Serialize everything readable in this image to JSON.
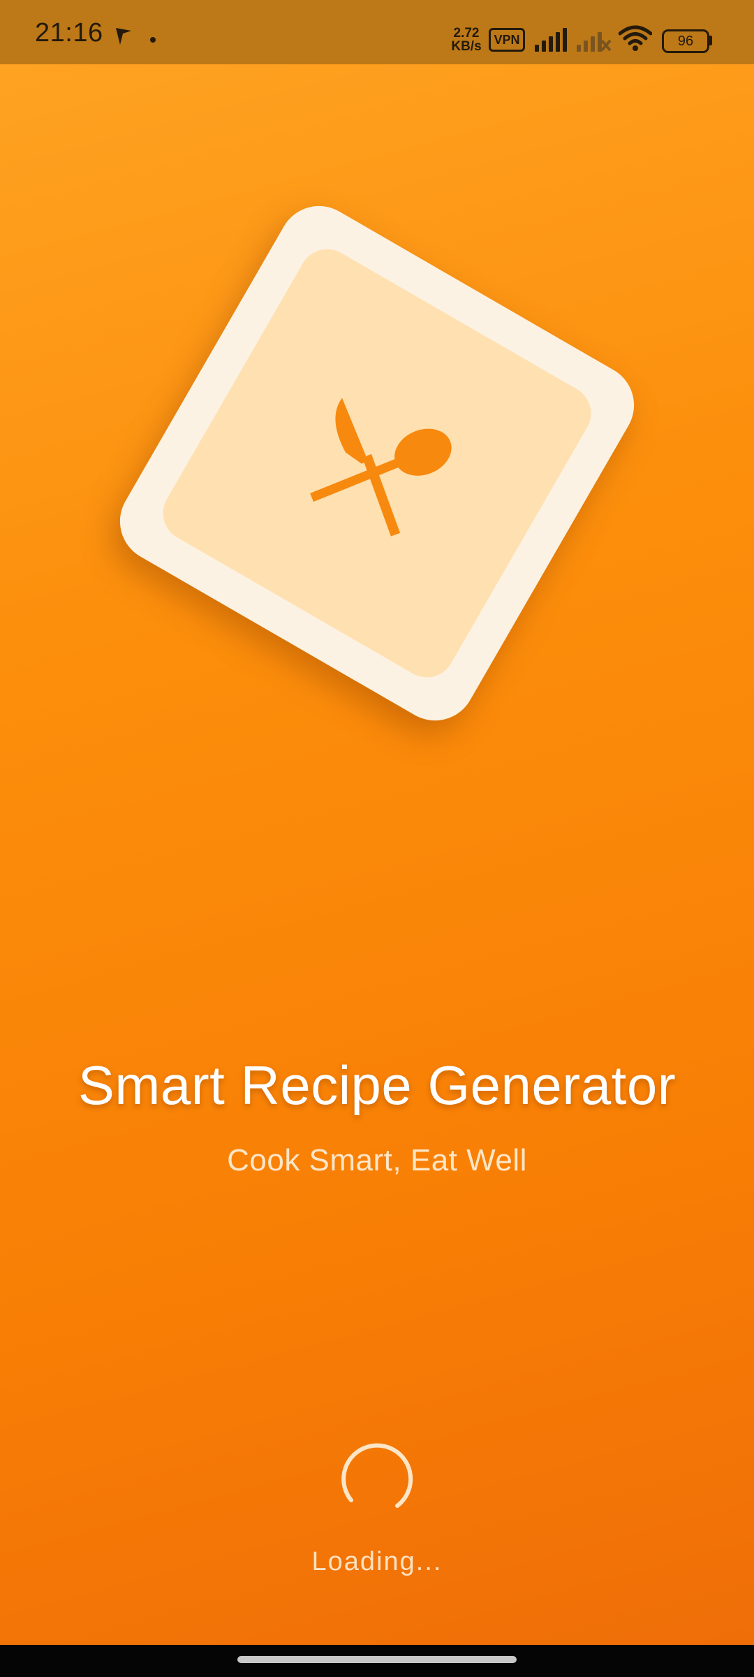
{
  "status_bar": {
    "time": "21:16",
    "net_speed_value": "2.72",
    "net_speed_unit": "KB/s",
    "vpn_label": "VPN",
    "battery_level": "96",
    "icons": [
      "navigation-arrow-icon",
      "notification-dot-icon",
      "signal-icon",
      "signal-no-service-icon",
      "wifi-icon",
      "battery-icon"
    ]
  },
  "splash": {
    "logo_icon": "fork-spoon-utensils-icon",
    "title": "Smart Recipe Generator",
    "subtitle": "Cook Smart, Eat Well",
    "loading_text": "Loading..."
  },
  "colors": {
    "background_top": "#ffa424",
    "background_bottom": "#ef6d08",
    "status_bar": "#bd7817",
    "logo_outer": "#fcf2e3",
    "logo_inner": "#ffe0b0",
    "icon_orange": "#f6890e"
  }
}
